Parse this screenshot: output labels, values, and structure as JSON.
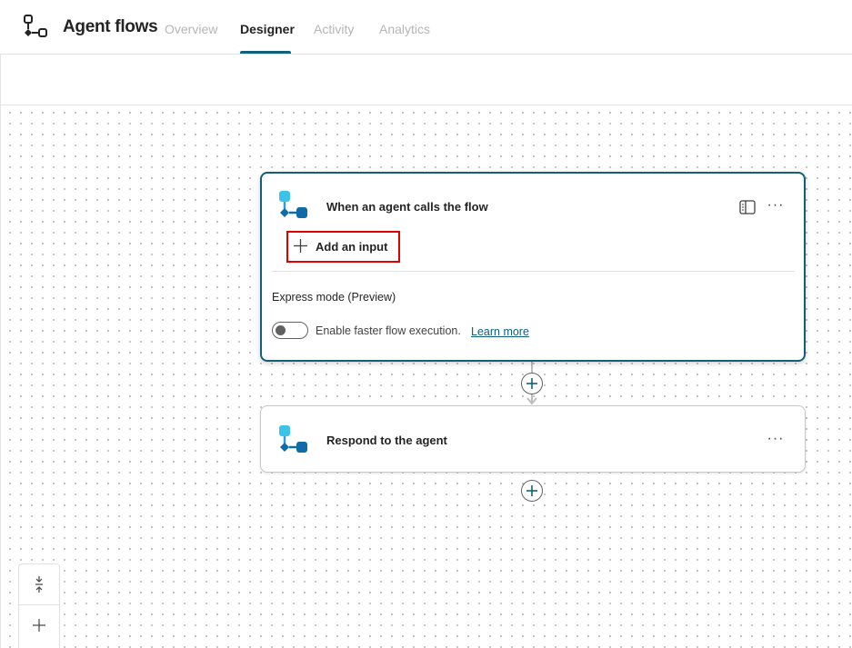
{
  "header": {
    "app_title": "Agent flows",
    "tabs": [
      {
        "label": "Overview",
        "active": false
      },
      {
        "label": "Designer",
        "active": true
      },
      {
        "label": "Activity",
        "active": false
      },
      {
        "label": "Analytics",
        "active": false
      }
    ]
  },
  "trigger_card": {
    "title": "When an agent calls the flow",
    "add_input_label": "Add an input",
    "express_mode_title": "Express mode (Preview)",
    "toggle_label": "Enable faster flow execution.",
    "toggle_on": false,
    "learn_more": "Learn more",
    "more_label": "···"
  },
  "respond_card": {
    "title": "Respond to the agent",
    "more_label": "···"
  },
  "icons": {
    "app": "flow-icon",
    "node": "agent-flow-node-icon",
    "panel": "panel-icon",
    "more": "more-horizontal-icon",
    "add_step": "add-circle-icon",
    "fit": "fit-view-icon",
    "zoom_in": "zoom-in-icon"
  },
  "colors": {
    "accent": "#11607a",
    "highlight_box": "#e00000",
    "node_light": "#3cc3e8",
    "node_dark": "#0f6ca8"
  }
}
